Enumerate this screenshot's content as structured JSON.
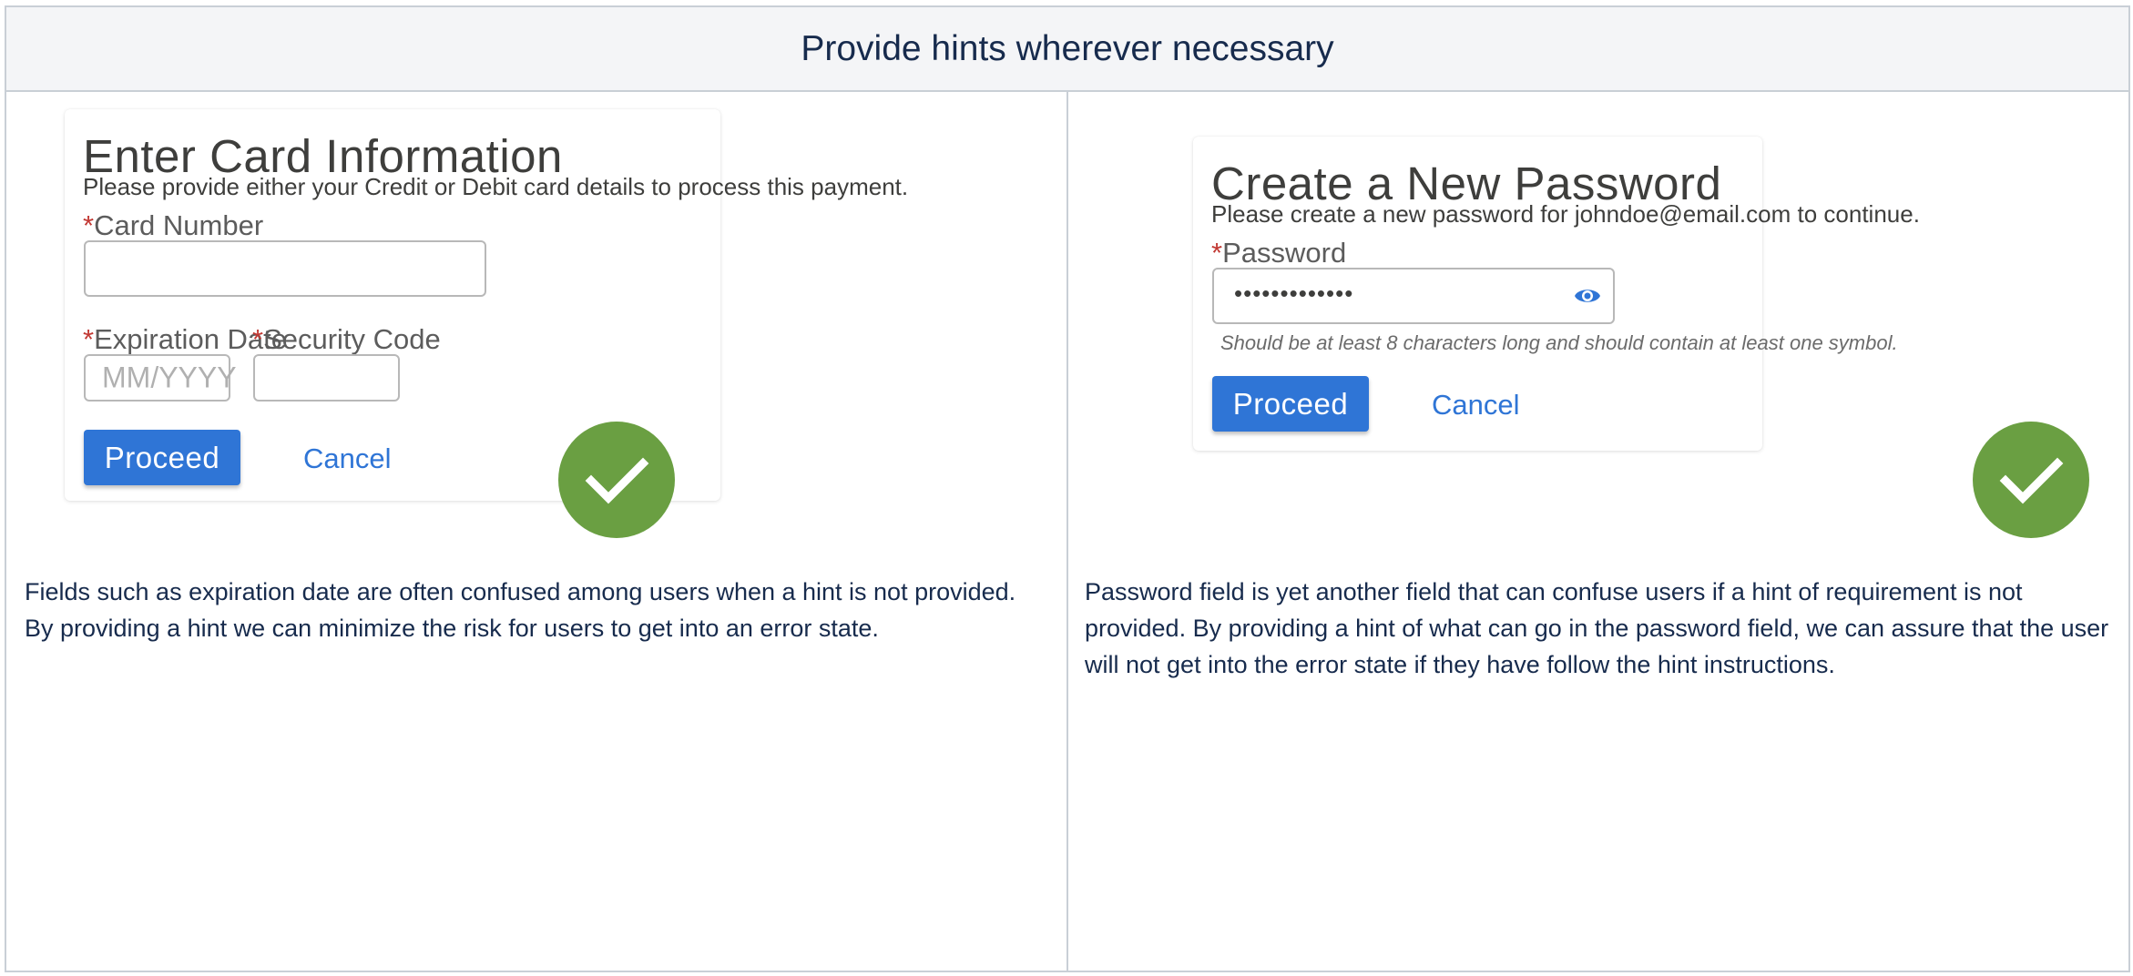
{
  "header": {
    "title": "Provide hints wherever necessary"
  },
  "left": {
    "card_title": "Enter Card Information",
    "card_subtitle": "Please provide either your Credit or Debit card details to process this payment.",
    "card_number_label": "Card Number",
    "expiration_label": "Expiration Date",
    "expiration_placeholder": "MM/YYYY",
    "security_label": "Security Code",
    "proceed_label": "Proceed",
    "cancel_label": "Cancel",
    "description": "Fields such as expiration date are often confused among users when a hint is not provided. By providing a hint we can minimize the risk for users to get into an error state."
  },
  "right": {
    "card_title": "Create a New Password",
    "card_subtitle": "Please create a new password for johndoe@email.com to continue.",
    "password_label": "Password",
    "password_value": "•••••••••••••",
    "hint": "Should be at least 8 characters long and should contain at least one symbol.",
    "proceed_label": "Proceed",
    "cancel_label": "Cancel",
    "description": "Password field is yet another field that can confuse users if a hint of requirement is not provided. By providing a hint of what can go in the password field, we can assure that the user will not get into the error state if they have follow the hint instructions."
  },
  "required_marker": "*",
  "colors": {
    "accent": "#2f75d6",
    "required": "#c23934",
    "success": "#6a9f42",
    "header_bg": "#f4f5f7"
  },
  "icons": [
    "eye-icon",
    "checkmark-icon"
  ]
}
